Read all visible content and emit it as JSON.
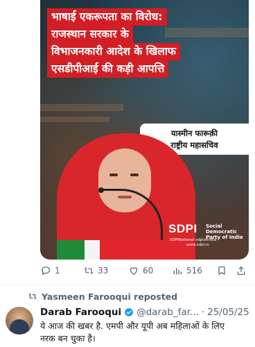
{
  "image_card": {
    "headline_lines": [
      "भाषाई एकरूपता का विरोध:",
      "राजस्थान सरकार के",
      "विभाजनकारी आदेश के खिलाफ",
      "एसडीपीआई की कड़ी आपत्ति"
    ],
    "person_name": "यास्मीन फारूक़ी",
    "person_title": "राष्ट्रीय महासचिव",
    "logo": {
      "main": "SDPI",
      "sub_lines": [
        "Social",
        "Democratic",
        "Party of India"
      ],
      "handles": "SDPINational  sdpiofindia",
      "website": "www.sdpi.in"
    },
    "colors": {
      "headline_bg": "#d21f25",
      "scarf": "#d8262b"
    }
  },
  "actions": {
    "replies": "1",
    "reposts": "33",
    "likes": "60",
    "views": "516"
  },
  "next_tweet": {
    "repost_label": "Yasmeen Farooqui reposted",
    "author": "Darab Farooqui",
    "handle": "@darab_far...",
    "separator": "·",
    "date": "25/05/25",
    "verified_color": "#1d9bf0",
    "text_line1": "ये आज की खबर है. एमपी और यूपी अब महिलाओं के लिए",
    "text_line2": "नरक बन चुका है।"
  }
}
